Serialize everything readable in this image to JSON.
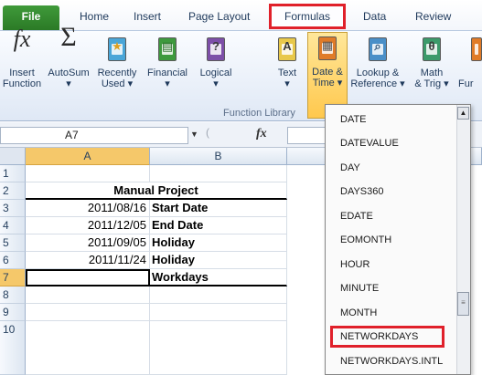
{
  "tabs": {
    "file": "File",
    "home": "Home",
    "insert": "Insert",
    "page_layout": "Page Layout",
    "formulas": "Formulas",
    "data": "Data",
    "review": "Review"
  },
  "ribbon": {
    "insert_function": [
      "Insert",
      "Function"
    ],
    "autosum": [
      "AutoSum",
      "▾"
    ],
    "recently_used": [
      "Recently",
      "Used ▾"
    ],
    "financial": [
      "Financial",
      "▾"
    ],
    "logical": [
      "Logical",
      "▾"
    ],
    "text": [
      "Text",
      "▾"
    ],
    "date_time": [
      "Date &",
      "Time ▾"
    ],
    "lookup_reference": [
      "Lookup &",
      "Reference ▾"
    ],
    "math_trig": [
      "Math",
      "& Trig ▾"
    ],
    "more_truncated": "Fur",
    "group_label": "Function Library",
    "glyphs": {
      "logical": "?",
      "text": "A",
      "math": "θ",
      "fx": "fx",
      "sigma": "Σ"
    }
  },
  "formula_bar": {
    "name_box": "A7",
    "fx_symbol": "fx"
  },
  "grid": {
    "columns": [
      "A",
      "B"
    ],
    "rows": [
      "1",
      "2",
      "3",
      "4",
      "5",
      "6",
      "7",
      "8",
      "9",
      "10"
    ],
    "title": "Manual Project",
    "entries": [
      {
        "date": "2011/08/16",
        "label": "Start Date"
      },
      {
        "date": "2011/12/05",
        "label": "End Date"
      },
      {
        "date": "2011/09/05",
        "label": "Holiday"
      },
      {
        "date": "2011/11/24",
        "label": "Holiday"
      },
      {
        "date": "",
        "label": "Workdays"
      }
    ]
  },
  "dropdown": {
    "items": [
      "DATE",
      "DATEVALUE",
      "DAY",
      "DAYS360",
      "EDATE",
      "EOMONTH",
      "HOUR",
      "MINUTE",
      "MONTH",
      "NETWORKDAYS",
      "NETWORKDAYS.INTL"
    ],
    "highlighted": "NETWORKDAYS",
    "scroll_up": "▲",
    "scroll_thumb": "≡"
  },
  "colors": {
    "file_tab": "#2b7a26",
    "highlight_red": "#e0202a",
    "selected_header": "#f5c86a"
  }
}
